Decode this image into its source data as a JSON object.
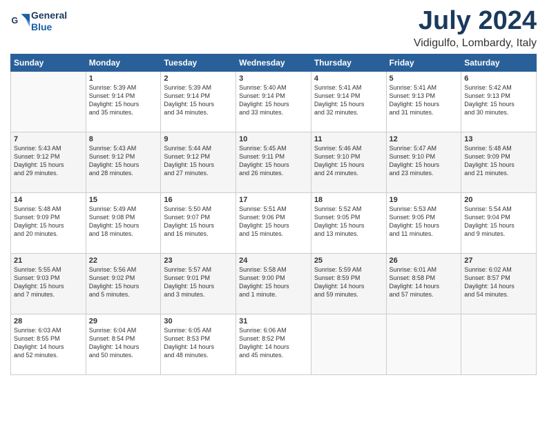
{
  "logo": {
    "line1": "General",
    "line2": "Blue"
  },
  "title": "July 2024",
  "location": "Vidigulfo, Lombardy, Italy",
  "weekdays": [
    "Sunday",
    "Monday",
    "Tuesday",
    "Wednesday",
    "Thursday",
    "Friday",
    "Saturday"
  ],
  "weeks": [
    [
      {
        "day": "",
        "info": ""
      },
      {
        "day": "1",
        "info": "Sunrise: 5:39 AM\nSunset: 9:14 PM\nDaylight: 15 hours\nand 35 minutes."
      },
      {
        "day": "2",
        "info": "Sunrise: 5:39 AM\nSunset: 9:14 PM\nDaylight: 15 hours\nand 34 minutes."
      },
      {
        "day": "3",
        "info": "Sunrise: 5:40 AM\nSunset: 9:14 PM\nDaylight: 15 hours\nand 33 minutes."
      },
      {
        "day": "4",
        "info": "Sunrise: 5:41 AM\nSunset: 9:14 PM\nDaylight: 15 hours\nand 32 minutes."
      },
      {
        "day": "5",
        "info": "Sunrise: 5:41 AM\nSunset: 9:13 PM\nDaylight: 15 hours\nand 31 minutes."
      },
      {
        "day": "6",
        "info": "Sunrise: 5:42 AM\nSunset: 9:13 PM\nDaylight: 15 hours\nand 30 minutes."
      }
    ],
    [
      {
        "day": "7",
        "info": "Sunrise: 5:43 AM\nSunset: 9:12 PM\nDaylight: 15 hours\nand 29 minutes."
      },
      {
        "day": "8",
        "info": "Sunrise: 5:43 AM\nSunset: 9:12 PM\nDaylight: 15 hours\nand 28 minutes."
      },
      {
        "day": "9",
        "info": "Sunrise: 5:44 AM\nSunset: 9:12 PM\nDaylight: 15 hours\nand 27 minutes."
      },
      {
        "day": "10",
        "info": "Sunrise: 5:45 AM\nSunset: 9:11 PM\nDaylight: 15 hours\nand 26 minutes."
      },
      {
        "day": "11",
        "info": "Sunrise: 5:46 AM\nSunset: 9:10 PM\nDaylight: 15 hours\nand 24 minutes."
      },
      {
        "day": "12",
        "info": "Sunrise: 5:47 AM\nSunset: 9:10 PM\nDaylight: 15 hours\nand 23 minutes."
      },
      {
        "day": "13",
        "info": "Sunrise: 5:48 AM\nSunset: 9:09 PM\nDaylight: 15 hours\nand 21 minutes."
      }
    ],
    [
      {
        "day": "14",
        "info": "Sunrise: 5:48 AM\nSunset: 9:09 PM\nDaylight: 15 hours\nand 20 minutes."
      },
      {
        "day": "15",
        "info": "Sunrise: 5:49 AM\nSunset: 9:08 PM\nDaylight: 15 hours\nand 18 minutes."
      },
      {
        "day": "16",
        "info": "Sunrise: 5:50 AM\nSunset: 9:07 PM\nDaylight: 15 hours\nand 16 minutes."
      },
      {
        "day": "17",
        "info": "Sunrise: 5:51 AM\nSunset: 9:06 PM\nDaylight: 15 hours\nand 15 minutes."
      },
      {
        "day": "18",
        "info": "Sunrise: 5:52 AM\nSunset: 9:05 PM\nDaylight: 15 hours\nand 13 minutes."
      },
      {
        "day": "19",
        "info": "Sunrise: 5:53 AM\nSunset: 9:05 PM\nDaylight: 15 hours\nand 11 minutes."
      },
      {
        "day": "20",
        "info": "Sunrise: 5:54 AM\nSunset: 9:04 PM\nDaylight: 15 hours\nand 9 minutes."
      }
    ],
    [
      {
        "day": "21",
        "info": "Sunrise: 5:55 AM\nSunset: 9:03 PM\nDaylight: 15 hours\nand 7 minutes."
      },
      {
        "day": "22",
        "info": "Sunrise: 5:56 AM\nSunset: 9:02 PM\nDaylight: 15 hours\nand 5 minutes."
      },
      {
        "day": "23",
        "info": "Sunrise: 5:57 AM\nSunset: 9:01 PM\nDaylight: 15 hours\nand 3 minutes."
      },
      {
        "day": "24",
        "info": "Sunrise: 5:58 AM\nSunset: 9:00 PM\nDaylight: 15 hours\nand 1 minute."
      },
      {
        "day": "25",
        "info": "Sunrise: 5:59 AM\nSunset: 8:59 PM\nDaylight: 14 hours\nand 59 minutes."
      },
      {
        "day": "26",
        "info": "Sunrise: 6:01 AM\nSunset: 8:58 PM\nDaylight: 14 hours\nand 57 minutes."
      },
      {
        "day": "27",
        "info": "Sunrise: 6:02 AM\nSunset: 8:57 PM\nDaylight: 14 hours\nand 54 minutes."
      }
    ],
    [
      {
        "day": "28",
        "info": "Sunrise: 6:03 AM\nSunset: 8:55 PM\nDaylight: 14 hours\nand 52 minutes."
      },
      {
        "day": "29",
        "info": "Sunrise: 6:04 AM\nSunset: 8:54 PM\nDaylight: 14 hours\nand 50 minutes."
      },
      {
        "day": "30",
        "info": "Sunrise: 6:05 AM\nSunset: 8:53 PM\nDaylight: 14 hours\nand 48 minutes."
      },
      {
        "day": "31",
        "info": "Sunrise: 6:06 AM\nSunset: 8:52 PM\nDaylight: 14 hours\nand 45 minutes."
      },
      {
        "day": "",
        "info": ""
      },
      {
        "day": "",
        "info": ""
      },
      {
        "day": "",
        "info": ""
      }
    ]
  ]
}
